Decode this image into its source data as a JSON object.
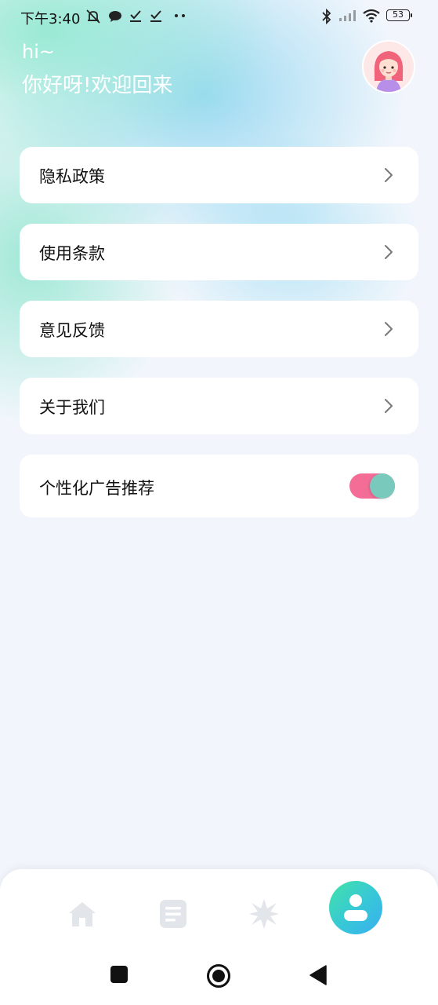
{
  "status_bar": {
    "time": "下午3:40",
    "battery": "53"
  },
  "header": {
    "greeting": "hi~",
    "welcome": "你好呀!欢迎回来"
  },
  "menu": {
    "items": [
      {
        "label": "隐私政策"
      },
      {
        "label": "使用条款"
      },
      {
        "label": "意见反馈"
      },
      {
        "label": "关于我们"
      }
    ]
  },
  "ad_setting": {
    "label": "个性化广告推荐",
    "enabled": true
  },
  "tabbar": {
    "tabs": [
      {
        "icon": "home-icon",
        "active": false
      },
      {
        "icon": "document-icon",
        "active": false
      },
      {
        "icon": "sparkle-icon",
        "active": false
      },
      {
        "icon": "profile-icon",
        "active": true
      }
    ]
  },
  "colors": {
    "toggle_track": "#f36d97",
    "toggle_knob": "#79c9bd",
    "active_tab_gradient": [
      "#42e2a8",
      "#3aaef0"
    ],
    "inactive_icon": "#e2e5ea"
  }
}
